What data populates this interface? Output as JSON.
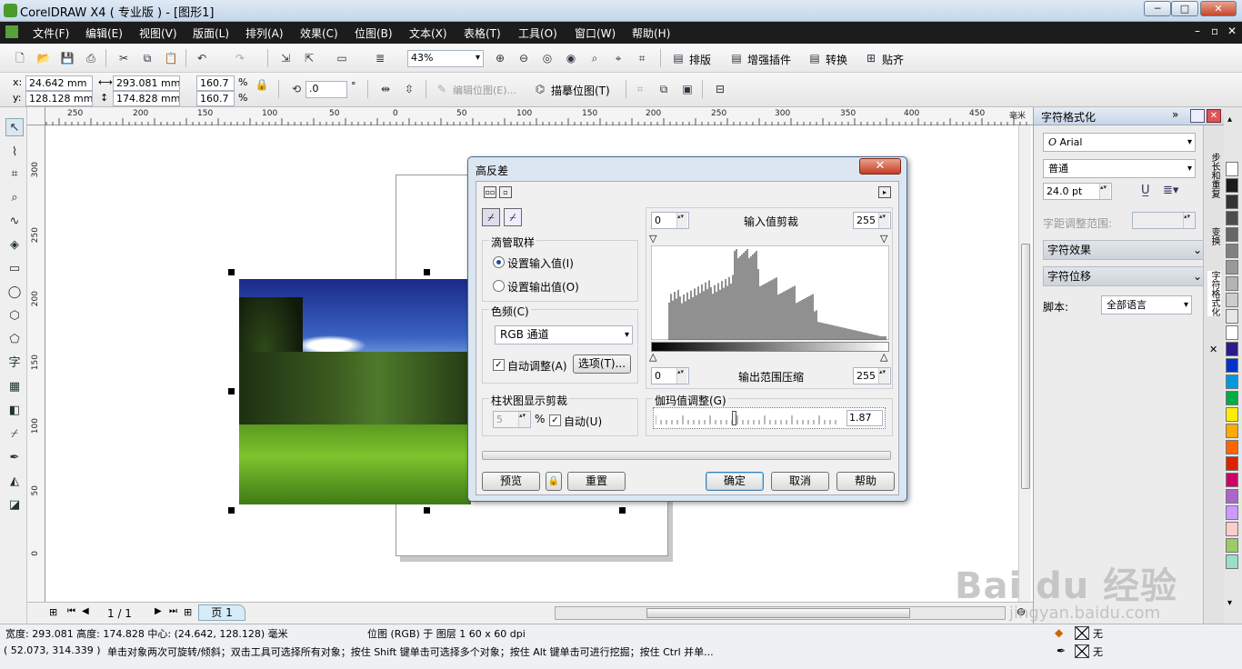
{
  "window": {
    "title": "CorelDRAW X4 ( 专业版 ) - [图形1]",
    "min": "─",
    "max": "□",
    "close": "✕"
  },
  "menu": [
    "文件(F)",
    "编辑(E)",
    "视图(V)",
    "版面(L)",
    "排列(A)",
    "效果(C)",
    "位图(B)",
    "文本(X)",
    "表格(T)",
    "工具(O)",
    "窗口(W)",
    "帮助(H)"
  ],
  "toolbar": {
    "zoom": "43%",
    "plugins": [
      {
        "label": "排版"
      },
      {
        "label": "增强插件"
      },
      {
        "label": "转换"
      },
      {
        "label": "贴齐"
      }
    ]
  },
  "propbar": {
    "x": "24.642 mm",
    "y": "128.128 mm",
    "w": "293.081 mm",
    "h": "174.828 mm",
    "sx": "160.7",
    "sy": "160.7",
    "pct": "%",
    "angle": ".0",
    "deg": "°",
    "edit_bitmap": "编辑位图(E)...",
    "trace_bitmap": "描摹位图(T)"
  },
  "ruler": {
    "h": [
      "250",
      "200",
      "150",
      "100",
      "50",
      "0",
      "50",
      "100",
      "150",
      "200",
      "250",
      "300",
      "350",
      "400",
      "450"
    ],
    "unit": "毫米",
    "v": [
      "300",
      "250",
      "200",
      "150",
      "100",
      "50",
      "0"
    ]
  },
  "page_nav": {
    "counter": "1 / 1",
    "tab": "页 1"
  },
  "status": {
    "line1": "宽度: 293.081  高度: 174.828  中心: (24.642, 128.128)  毫米",
    "layer": "位图 (RGB) 于 图层 1 60 x 60 dpi",
    "coords": "( 52.073, 314.339 )",
    "hint": "单击对象两次可旋转/倾斜；双击工具可选择所有对象；按住 Shift 键单击可选择多个对象；按住 Alt 键单击可进行挖掘；按住 Ctrl 并单...",
    "fill": "无",
    "outline": "无"
  },
  "docker": {
    "title": "字符格式化",
    "font": "Arial",
    "style": "普通",
    "size": "24.0 pt",
    "kerning_label": "字距调整范围:",
    "effects": "字符效果",
    "shift": "字符位移",
    "script_label": "脚本:",
    "script_value": "全部语言",
    "tabs": [
      "步长和重复",
      "变换",
      "字符格式化"
    ]
  },
  "dialog": {
    "title": "高反差",
    "sample_group": "滴管取样",
    "radio_in": "设置输入值(I)",
    "radio_out": "设置输出值(O)",
    "channel_group": "色频(C)",
    "channel": "RGB 通道",
    "auto_adjust": "自动调整(A)",
    "options": "选项(T)...",
    "clip_group": "柱状图显示剪裁",
    "clip_val": "5",
    "clip_pct": "%",
    "auto": "自动(U)",
    "in_low": "0",
    "in_label": "输入值剪裁",
    "in_high": "255",
    "out_low": "0",
    "out_label": "输出范围压缩",
    "out_high": "255",
    "gamma_label": "伽玛值调整(G)",
    "gamma_val": "1.87",
    "preview": "预览",
    "reset": "重置",
    "ok": "确定",
    "cancel": "取消",
    "help": "帮助"
  },
  "palette": [
    "#ffffff",
    "#1a1a1a",
    "#333333",
    "#4d4d4d",
    "#666666",
    "#808080",
    "#999999",
    "#b3b3b3",
    "#cccccc",
    "#e6e6e6",
    "#ffffff",
    "#2b1c8c",
    "#0033cc",
    "#0099dd",
    "#00aa44",
    "#ffee00",
    "#ffaa00",
    "#ff6600",
    "#dd2200",
    "#cc0066",
    "#aa66cc",
    "#cc99ff",
    "#ffcccc",
    "#99cc66",
    "#99ddcc"
  ],
  "watermark": {
    "brand": "Bai du 经验",
    "url": "jingyan.baidu.com"
  }
}
